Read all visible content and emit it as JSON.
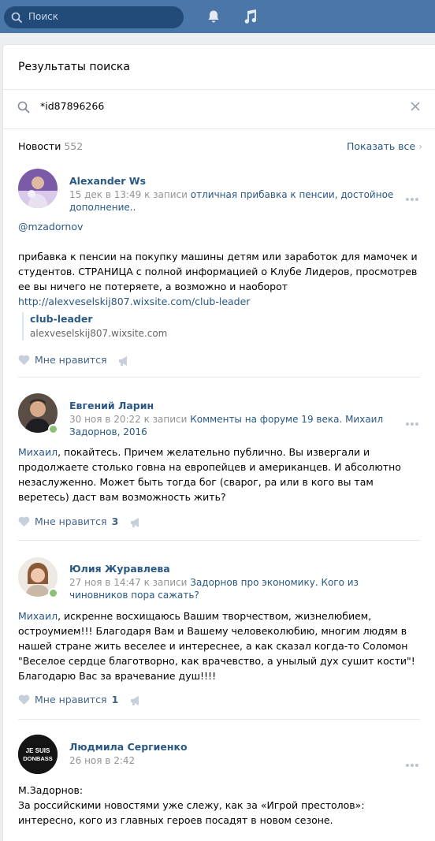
{
  "topbar": {
    "search_placeholder": "Поиск",
    "brand_color": "#4a76a8"
  },
  "page": {
    "title": "Результаты поиска",
    "query": "*id87896266",
    "section_title": "Новости",
    "section_count": "552",
    "show_all": "Показать все"
  },
  "posts": [
    {
      "author": "Alexander Ws",
      "meta_date": "15 дек в 13:49",
      "meta_prefix": " к записи ",
      "meta_link": "отличная прибавка к пенсии, достойное дополнение..",
      "text_mention": "@mzadornov",
      "text_body": "прибавка к пенсии на покупку машины детям или заработок для мамочек и студентов. СТРАНИЦА с полной информацией о Клубе Лидеров, просмотрев ее вы ничего не потеряете, а возможно и наоборот",
      "text_link": "http://alexveselskij807.wixsite.com/club-leader",
      "attachment_title": "club-leader",
      "attachment_url": "alexveselskij807.wixsite.com",
      "like_label": "Мне нравится",
      "like_count": ""
    },
    {
      "author": "Евгений Ларин",
      "meta_date": "30 ноя в 20:22",
      "meta_prefix": " к записи ",
      "meta_link": "Комменты на форуме 19 века. Михаил Задорнов, 2016",
      "text_name": "Михаил",
      "text_body": ", покайтесь. Причем желательно публично. Вы извергали и продолжаете столько говна на европейцев и американцев. И абсолютно незаслуженно. Может быть тогда бог (сварог, ра или в кого вы там веретесь) даст вам возможность жить?",
      "like_label": "Мне нравится",
      "like_count": "3"
    },
    {
      "author": "Юлия Журавлева",
      "meta_date": "27 ноя в 14:47",
      "meta_prefix": " к записи ",
      "meta_link": "Задорнов про экономику. Кого из чиновников пора сажать?",
      "text_name": "Михаил",
      "text_body": ", искренне восхищаюсь Вашим творчеством, жизнелюбием, остроумием!!! Благодаря Вам и Вашему человеколюбию, многим людям в нашей стране жить веселее и интереснее, а как сказал когда-то Соломон \"Веселое сердце благотворно, как врачевство, а унылый дух сушит кости\"! Благодарю Вас за врачевание душ!!!!",
      "like_label": "Мне нравится",
      "like_count": "1"
    },
    {
      "author": "Людмила Сергиенко",
      "meta_date": "26 ноя в 2:42",
      "avatar_text_1": "JE SUIS",
      "avatar_text_2": "DONBASS",
      "text_line1": "М.Задорнов:",
      "text_body": "За российскими новостями уже слежу, как за «Игрой престолов»: интересно, кого из главных героев посадят в новом сезоне."
    }
  ]
}
